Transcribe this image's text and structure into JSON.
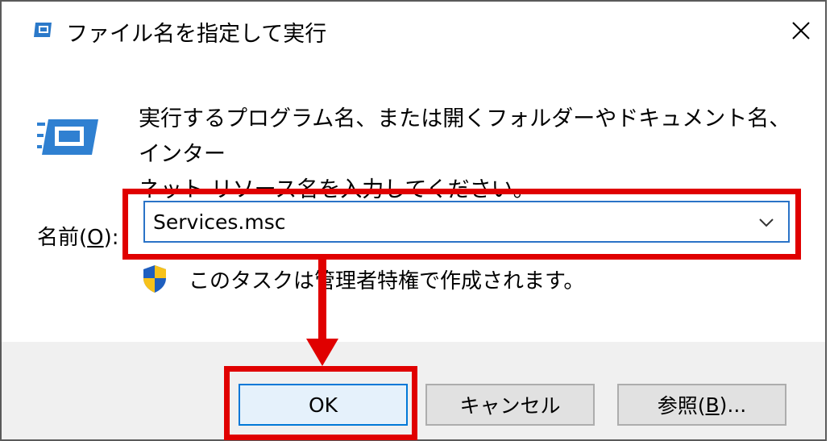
{
  "window": {
    "title": "ファイル名を指定して実行",
    "close_glyph": "✕"
  },
  "description": "実行するプログラム名、または開くフォルダーやドキュメント名、インター\nネット リソース名を入力してください。",
  "name_field": {
    "label_prefix": "名前(",
    "label_accel": "O",
    "label_suffix": "):",
    "value": "Services.msc"
  },
  "admin_notice": "このタスクは管理者特権で作成されます。",
  "buttons": {
    "ok_label": "OK",
    "cancel_label": "キャンセル",
    "browse_prefix": "参照(",
    "browse_accel": "B",
    "browse_suffix": ")..."
  },
  "colors": {
    "highlight": "#e00000",
    "focus_border": "#0078d7"
  },
  "icons": {
    "title": "run-dialog-icon",
    "body": "run-dialog-icon",
    "shield": "uac-shield-icon",
    "dropdown": "chevron-down-icon"
  }
}
